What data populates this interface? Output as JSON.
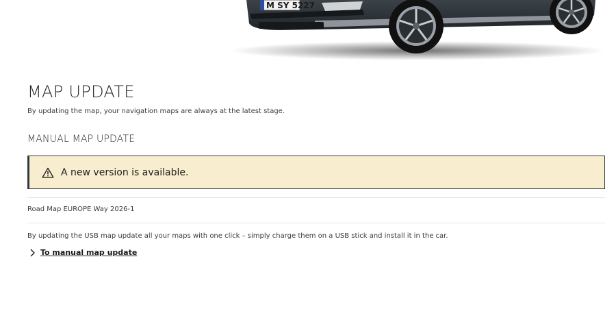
{
  "hero": {
    "license_plate": "M SY 5227"
  },
  "page": {
    "title": "MAP UPDATE",
    "subtitle": "By updating the map, your navigation maps are always at the latest stage."
  },
  "manual_section": {
    "title": "MANUAL MAP UPDATE",
    "notice": {
      "icon": "warning-icon",
      "text": "A new version is available.",
      "background_color": "#f8edce",
      "border_color": "#30383e"
    },
    "map_version": "Road Map EUROPE Way 2026-1",
    "description": "By updating the USB map update all your maps with one click – simply charge them on a USB stick and install it in the car.",
    "link": {
      "icon": "chevron-right-icon",
      "label": "To manual map update"
    }
  }
}
